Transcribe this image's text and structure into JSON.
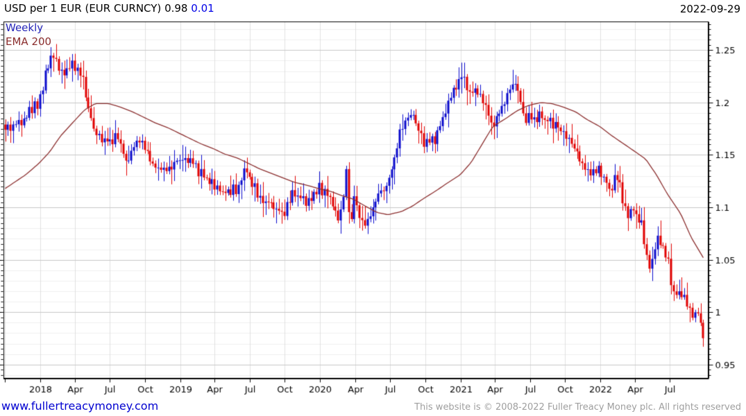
{
  "header": {
    "title": "USD per 1 EUR (EUR CURNCY)",
    "price": "0.98",
    "change": "0.01",
    "date": "2022-09-29"
  },
  "legend": {
    "timeframe": "Weekly",
    "overlay": "EMA 200"
  },
  "footer": {
    "link": "www.fullertreacymoney.com",
    "copyright": "This website is © 2008-2022 Fuller Treacy Money plc. All rights reserved"
  },
  "colors": {
    "up_candle": "#0a0acc",
    "down_candle": "#e00000",
    "ema_line": "#8b2e2e",
    "grid_major": "#c7c7c7",
    "grid_minor": "#efefef",
    "grid_vertical": "#e0e0e0",
    "axis": "#000000",
    "change_text": "#0000e6",
    "weekly_text": "#2424b8",
    "link_text": "#0000d0",
    "copyright_text": "#9e9e9e"
  },
  "chart_data": {
    "type": "candlestick",
    "title": "USD per 1 EUR (EUR CURNCY)",
    "frequency": "weekly",
    "overlay": "EMA 200",
    "start_date": "2017-10-02",
    "end_date": "2022-09-26",
    "last": {
      "close": 0.98,
      "change": 0.01,
      "low_wick": 0.953
    },
    "ylim": [
      0.937,
      1.277
    ],
    "grid": {
      "y_major_step": 0.05,
      "y_minor_step": 0.01,
      "tick_minor_step": 0.005
    },
    "y_major_ticks": [
      {
        "v": 1.25,
        "label": "1.25"
      },
      {
        "v": 1.2,
        "label": "1.2"
      },
      {
        "v": 1.15,
        "label": "1.15"
      },
      {
        "v": 1.1,
        "label": "1.1"
      },
      {
        "v": 1.05,
        "label": "1.05"
      },
      {
        "v": 1.0,
        "label": "1"
      },
      {
        "v": 0.95,
        "label": "0.95"
      }
    ],
    "x_ticks": [
      {
        "date": "2017-10-01",
        "label": ""
      },
      {
        "date": "2018-01-01",
        "label": "2018"
      },
      {
        "date": "2018-04-01",
        "label": "Apr"
      },
      {
        "date": "2018-07-01",
        "label": "Jul"
      },
      {
        "date": "2018-10-01",
        "label": "Oct"
      },
      {
        "date": "2019-01-01",
        "label": "2019"
      },
      {
        "date": "2019-04-01",
        "label": "Apr"
      },
      {
        "date": "2019-07-01",
        "label": "Jul"
      },
      {
        "date": "2019-10-01",
        "label": "Oct"
      },
      {
        "date": "2020-01-01",
        "label": "2020"
      },
      {
        "date": "2020-04-01",
        "label": "Apr"
      },
      {
        "date": "2020-07-01",
        "label": "Jul"
      },
      {
        "date": "2020-10-01",
        "label": "Oct"
      },
      {
        "date": "2021-01-01",
        "label": "2021"
      },
      {
        "date": "2021-04-01",
        "label": "Apr"
      },
      {
        "date": "2021-07-01",
        "label": "Jul"
      },
      {
        "date": "2021-10-01",
        "label": "Oct"
      },
      {
        "date": "2022-01-01",
        "label": "2022"
      },
      {
        "date": "2022-04-01",
        "label": "Apr"
      },
      {
        "date": "2022-07-01",
        "label": "Jul"
      }
    ],
    "close_anchors": [
      [
        "2017-10-02",
        1.175
      ],
      [
        "2017-10-27",
        1.178
      ],
      [
        "2017-11-24",
        1.188
      ],
      [
        "2017-12-29",
        1.201
      ],
      [
        "2018-01-26",
        1.242
      ],
      [
        "2018-02-16",
        1.24
      ],
      [
        "2018-02-23",
        1.229
      ],
      [
        "2018-03-23",
        1.235
      ],
      [
        "2018-04-20",
        1.228
      ],
      [
        "2018-04-27",
        1.212
      ],
      [
        "2018-05-25",
        1.167
      ],
      [
        "2018-06-29",
        1.166
      ],
      [
        "2018-07-27",
        1.166
      ],
      [
        "2018-08-17",
        1.142
      ],
      [
        "2018-08-31",
        1.16
      ],
      [
        "2018-09-28",
        1.161
      ],
      [
        "2018-10-26",
        1.14
      ],
      [
        "2018-11-23",
        1.132
      ],
      [
        "2018-12-28",
        1.146
      ],
      [
        "2019-01-25",
        1.143
      ],
      [
        "2019-02-22",
        1.134
      ],
      [
        "2019-03-29",
        1.122
      ],
      [
        "2019-04-26",
        1.115
      ],
      [
        "2019-05-31",
        1.118
      ],
      [
        "2019-06-21",
        1.137
      ],
      [
        "2019-07-26",
        1.112
      ],
      [
        "2019-08-30",
        1.099
      ],
      [
        "2019-09-27",
        1.092
      ],
      [
        "2019-10-25",
        1.115
      ],
      [
        "2019-11-29",
        1.102
      ],
      [
        "2019-12-27",
        1.12
      ],
      [
        "2020-01-31",
        1.108
      ],
      [
        "2020-02-21",
        1.085
      ],
      [
        "2020-03-09",
        1.136
      ],
      [
        "2020-03-20",
        1.069
      ],
      [
        "2020-03-27",
        1.114
      ],
      [
        "2020-04-24",
        1.082
      ],
      [
        "2020-05-29",
        1.11
      ],
      [
        "2020-06-26",
        1.122
      ],
      [
        "2020-07-31",
        1.178
      ],
      [
        "2020-08-28",
        1.19
      ],
      [
        "2020-09-25",
        1.163
      ],
      [
        "2020-10-30",
        1.165
      ],
      [
        "2020-11-27",
        1.196
      ],
      [
        "2020-12-31",
        1.222
      ],
      [
        "2021-01-08",
        1.222
      ],
      [
        "2021-01-29",
        1.21
      ],
      [
        "2021-02-26",
        1.207
      ],
      [
        "2021-03-26",
        1.179
      ],
      [
        "2021-04-30",
        1.202
      ],
      [
        "2021-05-21",
        1.222
      ],
      [
        "2021-06-18",
        1.186
      ],
      [
        "2021-07-30",
        1.187
      ],
      [
        "2021-08-27",
        1.179
      ],
      [
        "2021-09-24",
        1.172
      ],
      [
        "2021-10-29",
        1.156
      ],
      [
        "2021-11-26",
        1.131
      ],
      [
        "2021-12-31",
        1.137
      ],
      [
        "2022-01-28",
        1.115
      ],
      [
        "2022-02-11",
        1.135
      ],
      [
        "2022-03-11",
        1.091
      ],
      [
        "2022-03-25",
        1.098
      ],
      [
        "2022-04-22",
        1.08
      ],
      [
        "2022-04-29",
        1.054
      ],
      [
        "2022-05-13",
        1.041
      ],
      [
        "2022-05-27",
        1.073
      ],
      [
        "2022-06-24",
        1.055
      ],
      [
        "2022-07-08",
        1.018
      ],
      [
        "2022-07-29",
        1.022
      ],
      [
        "2022-08-26",
        0.996
      ],
      [
        "2022-09-16",
        1.002
      ],
      [
        "2022-09-23",
        0.961
      ],
      [
        "2022-09-26",
        0.98
      ]
    ],
    "ema_anchors": [
      [
        "2017-10-02",
        1.118
      ],
      [
        "2017-11-24",
        1.131
      ],
      [
        "2017-12-29",
        1.142
      ],
      [
        "2018-01-26",
        1.153
      ],
      [
        "2018-02-23",
        1.168
      ],
      [
        "2018-03-30",
        1.182
      ],
      [
        "2018-04-27",
        1.193
      ],
      [
        "2018-05-25",
        1.199
      ],
      [
        "2018-06-29",
        1.199
      ],
      [
        "2018-07-27",
        1.196
      ],
      [
        "2018-08-31",
        1.191
      ],
      [
        "2018-09-28",
        1.186
      ],
      [
        "2018-10-26",
        1.181
      ],
      [
        "2018-11-30",
        1.176
      ],
      [
        "2018-12-28",
        1.171
      ],
      [
        "2019-01-25",
        1.166
      ],
      [
        "2019-02-22",
        1.161
      ],
      [
        "2019-03-29",
        1.156
      ],
      [
        "2019-04-26",
        1.151
      ],
      [
        "2019-05-31",
        1.147
      ],
      [
        "2019-06-28",
        1.142
      ],
      [
        "2019-07-26",
        1.137
      ],
      [
        "2019-08-30",
        1.132
      ],
      [
        "2019-09-27",
        1.128
      ],
      [
        "2019-10-25",
        1.124
      ],
      [
        "2019-11-29",
        1.121
      ],
      [
        "2019-12-27",
        1.118
      ],
      [
        "2020-01-31",
        1.115
      ],
      [
        "2020-02-28",
        1.111
      ],
      [
        "2020-03-27",
        1.108
      ],
      [
        "2020-04-24",
        1.102
      ],
      [
        "2020-05-29",
        1.095
      ],
      [
        "2020-06-26",
        1.093
      ],
      [
        "2020-07-31",
        1.096
      ],
      [
        "2020-08-28",
        1.101
      ],
      [
        "2020-09-25",
        1.108
      ],
      [
        "2020-10-30",
        1.116
      ],
      [
        "2020-11-27",
        1.123
      ],
      [
        "2020-12-31",
        1.131
      ],
      [
        "2021-01-29",
        1.143
      ],
      [
        "2021-02-26",
        1.16
      ],
      [
        "2021-03-26",
        1.177
      ],
      [
        "2021-04-30",
        1.185
      ],
      [
        "2021-05-28",
        1.192
      ],
      [
        "2021-06-25",
        1.197
      ],
      [
        "2021-07-30",
        1.2
      ],
      [
        "2021-08-27",
        1.199
      ],
      [
        "2021-09-24",
        1.196
      ],
      [
        "2021-10-29",
        1.191
      ],
      [
        "2021-11-26",
        1.184
      ],
      [
        "2021-12-31",
        1.177
      ],
      [
        "2022-01-28",
        1.169
      ],
      [
        "2022-02-25",
        1.162
      ],
      [
        "2022-03-25",
        1.155
      ],
      [
        "2022-04-29",
        1.146
      ],
      [
        "2022-05-27",
        1.131
      ],
      [
        "2022-06-24",
        1.113
      ],
      [
        "2022-07-29",
        1.094
      ],
      [
        "2022-08-26",
        1.071
      ],
      [
        "2022-09-26",
        1.052
      ]
    ]
  }
}
